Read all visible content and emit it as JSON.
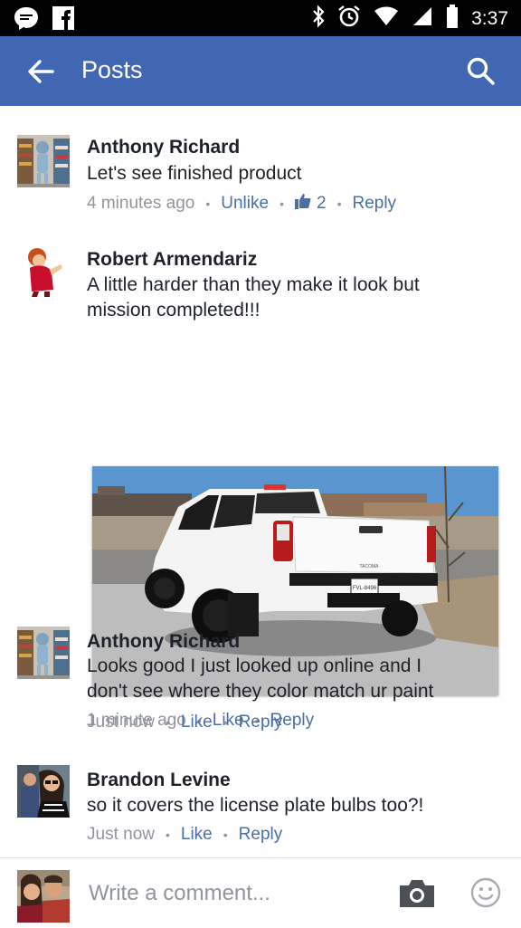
{
  "status_bar": {
    "time": "3:37"
  },
  "header": {
    "title": "Posts"
  },
  "comments": [
    {
      "author": "Anthony Richard",
      "lines": [
        "Let's see finished product"
      ],
      "time": "4 minutes ago",
      "action": "Unlike",
      "like_count": "2",
      "reply": "Reply"
    },
    {
      "author": "Robert Armendariz",
      "lines": [
        "A little harder than they make it look but",
        "mission completed!!!"
      ],
      "time": "1 minute ago",
      "action": "Like",
      "reply": "Reply",
      "photo": {
        "plate": "FVL-8496",
        "badge": "TACOMA"
      }
    },
    {
      "author": "Anthony Richard",
      "lines": [
        "Looks good I just looked up online and I",
        "don't see where they color match ur paint"
      ],
      "time": "Just now",
      "action": "Like",
      "reply": "Reply"
    },
    {
      "author": "Brandon Levine",
      "lines": [
        "so it covers the license plate bulbs too?!"
      ],
      "time": "Just now",
      "action": "Like",
      "reply": "Reply"
    }
  ],
  "composer": {
    "placeholder": "Write a comment..."
  },
  "colors": {
    "brand": "#4267b2",
    "link": "#4b6ea9",
    "meta": "#90949c"
  },
  "icons": [
    "messenger-icon",
    "facebook-icon",
    "bluetooth-icon",
    "alarm-icon",
    "wifi-icon",
    "signal-icon",
    "battery-icon",
    "back-arrow-icon",
    "search-icon",
    "like-thumb-icon",
    "camera-icon",
    "emoji-icon"
  ]
}
